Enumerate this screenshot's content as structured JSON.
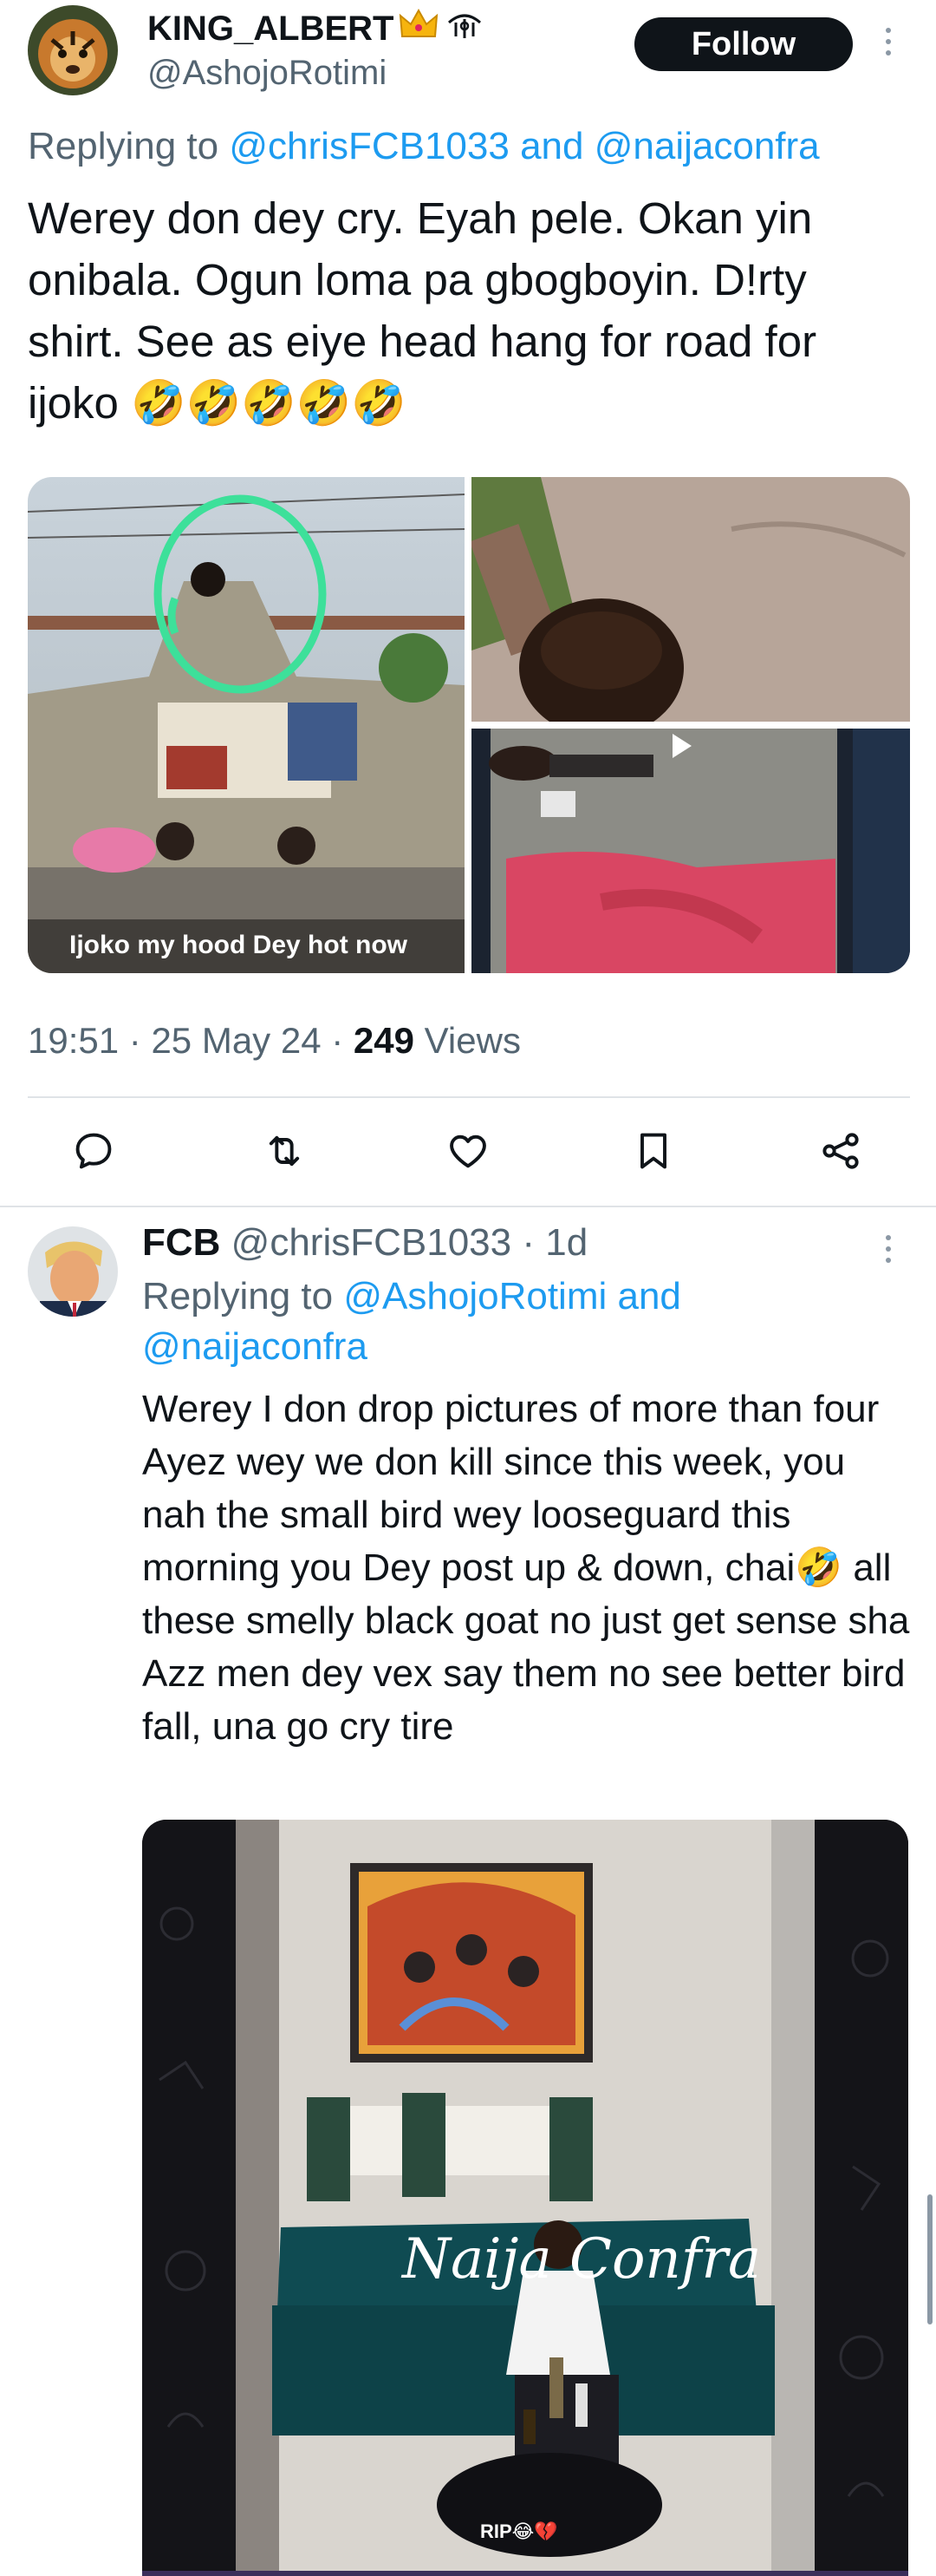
{
  "tweet": {
    "author_name": "KING_ALBERT",
    "author_handle": "@AshojoRotimi",
    "follow_label": "Follow",
    "replying_prefix": "Replying to",
    "replying_user1": "@chrisFCB1033",
    "replying_and": "and",
    "replying_user2": "@naijaconfra",
    "text": "Werey don dey cry. Eyah pele. Okan yin onibala. Ogun loma pa gbogboyin. D!rty shirt. See as eiye head hang for road for ijoko 🤣🤣🤣🤣🤣",
    "media_caption": "Ijoko my hood Dey hot now",
    "time": "19:51",
    "date": "25 May 24",
    "views_count": "249",
    "views_label": "Views",
    "sep": "·"
  },
  "reply": {
    "author_name": "FCB",
    "author_handle": "@chrisFCB1033",
    "age": "1d",
    "replying_prefix": "Replying to",
    "replying_user1": "@AshojoRotimi",
    "replying_and": "and",
    "replying_user2": "@naijaconfra",
    "text": "Werey I don drop pictures of more than four Ayez wey we don kill since this week, you nah the small bird wey looseguard this morning you Dey post up & down, chai🤣 all these smelly black goat no just get sense sha\nAzz men dey vex say them no see better bird fall, una go cry tire",
    "video_watermark": "Naija Confra",
    "video_caption": "RIP😂💔"
  },
  "colors": {
    "accent": "#1d9bf0",
    "text": "#0f1419",
    "secondary": "#536471",
    "follow_bg": "#0f1419"
  },
  "icons": [
    "reply-icon",
    "retweet-icon",
    "like-icon",
    "bookmark-icon",
    "share-icon",
    "more-icon",
    "crown-icon",
    "tag-icon"
  ]
}
